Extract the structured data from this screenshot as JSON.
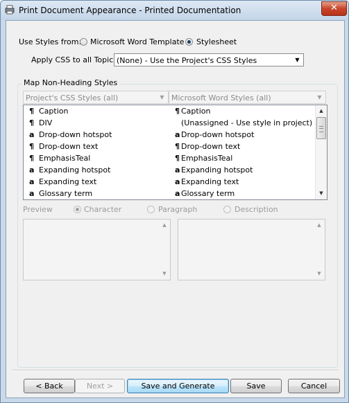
{
  "window": {
    "title": "Print Document Appearance - Printed Documentation",
    "close_glyph": "✕"
  },
  "use_styles": {
    "label": "Use Styles from:",
    "options": [
      {
        "label": "Microsoft Word Template",
        "selected": false
      },
      {
        "label": "Stylesheet",
        "selected": true
      }
    ]
  },
  "apply_css": {
    "label": "Apply CSS to all Topics:",
    "value": "(None) - Use the Project's CSS Styles"
  },
  "map_group": {
    "title": "Map Non-Heading Styles",
    "left_combo": "Project's CSS Styles (all)",
    "right_combo": "Microsoft Word Styles (all)",
    "rows": [
      {
        "left_icon": "¶",
        "left": "Caption",
        "right_icon": "¶",
        "right": "Caption"
      },
      {
        "left_icon": "¶",
        "left": "DIV",
        "right_icon": "",
        "right": "(Unassigned - Use style in project)"
      },
      {
        "left_icon": "a",
        "left": "Drop-down hotspot",
        "right_icon": "a",
        "right": "Drop-down hotspot"
      },
      {
        "left_icon": "¶",
        "left": "Drop-down text",
        "right_icon": "¶",
        "right": "Drop-down text"
      },
      {
        "left_icon": "¶",
        "left": "EmphasisTeal",
        "right_icon": "¶",
        "right": "EmphasisTeal"
      },
      {
        "left_icon": "a",
        "left": "Expanding hotspot",
        "right_icon": "a",
        "right": "Expanding hotspot"
      },
      {
        "left_icon": "a",
        "left": "Expanding text",
        "right_icon": "a",
        "right": "Expanding text"
      },
      {
        "left_icon": "a",
        "left": "Glossary term",
        "right_icon": "a",
        "right": "Glossary term"
      }
    ],
    "preview": {
      "label": "Preview",
      "options": [
        {
          "label": "Character",
          "selected": true
        },
        {
          "label": "Paragraph",
          "selected": false
        },
        {
          "label": "Description",
          "selected": false
        }
      ]
    }
  },
  "buttons": {
    "back": "< Back",
    "next": "Next >",
    "save_generate": "Save and Generate",
    "save": "Save",
    "cancel": "Cancel"
  },
  "scroll_glyphs": {
    "up": "▲",
    "down": "▼",
    "combo": "▼"
  },
  "icons": {
    "app": "printer-icon"
  },
  "colors": {
    "title_bar": "#c4d5e8",
    "close_button": "#c7452a",
    "default_button_border": "#3c7fb1"
  }
}
